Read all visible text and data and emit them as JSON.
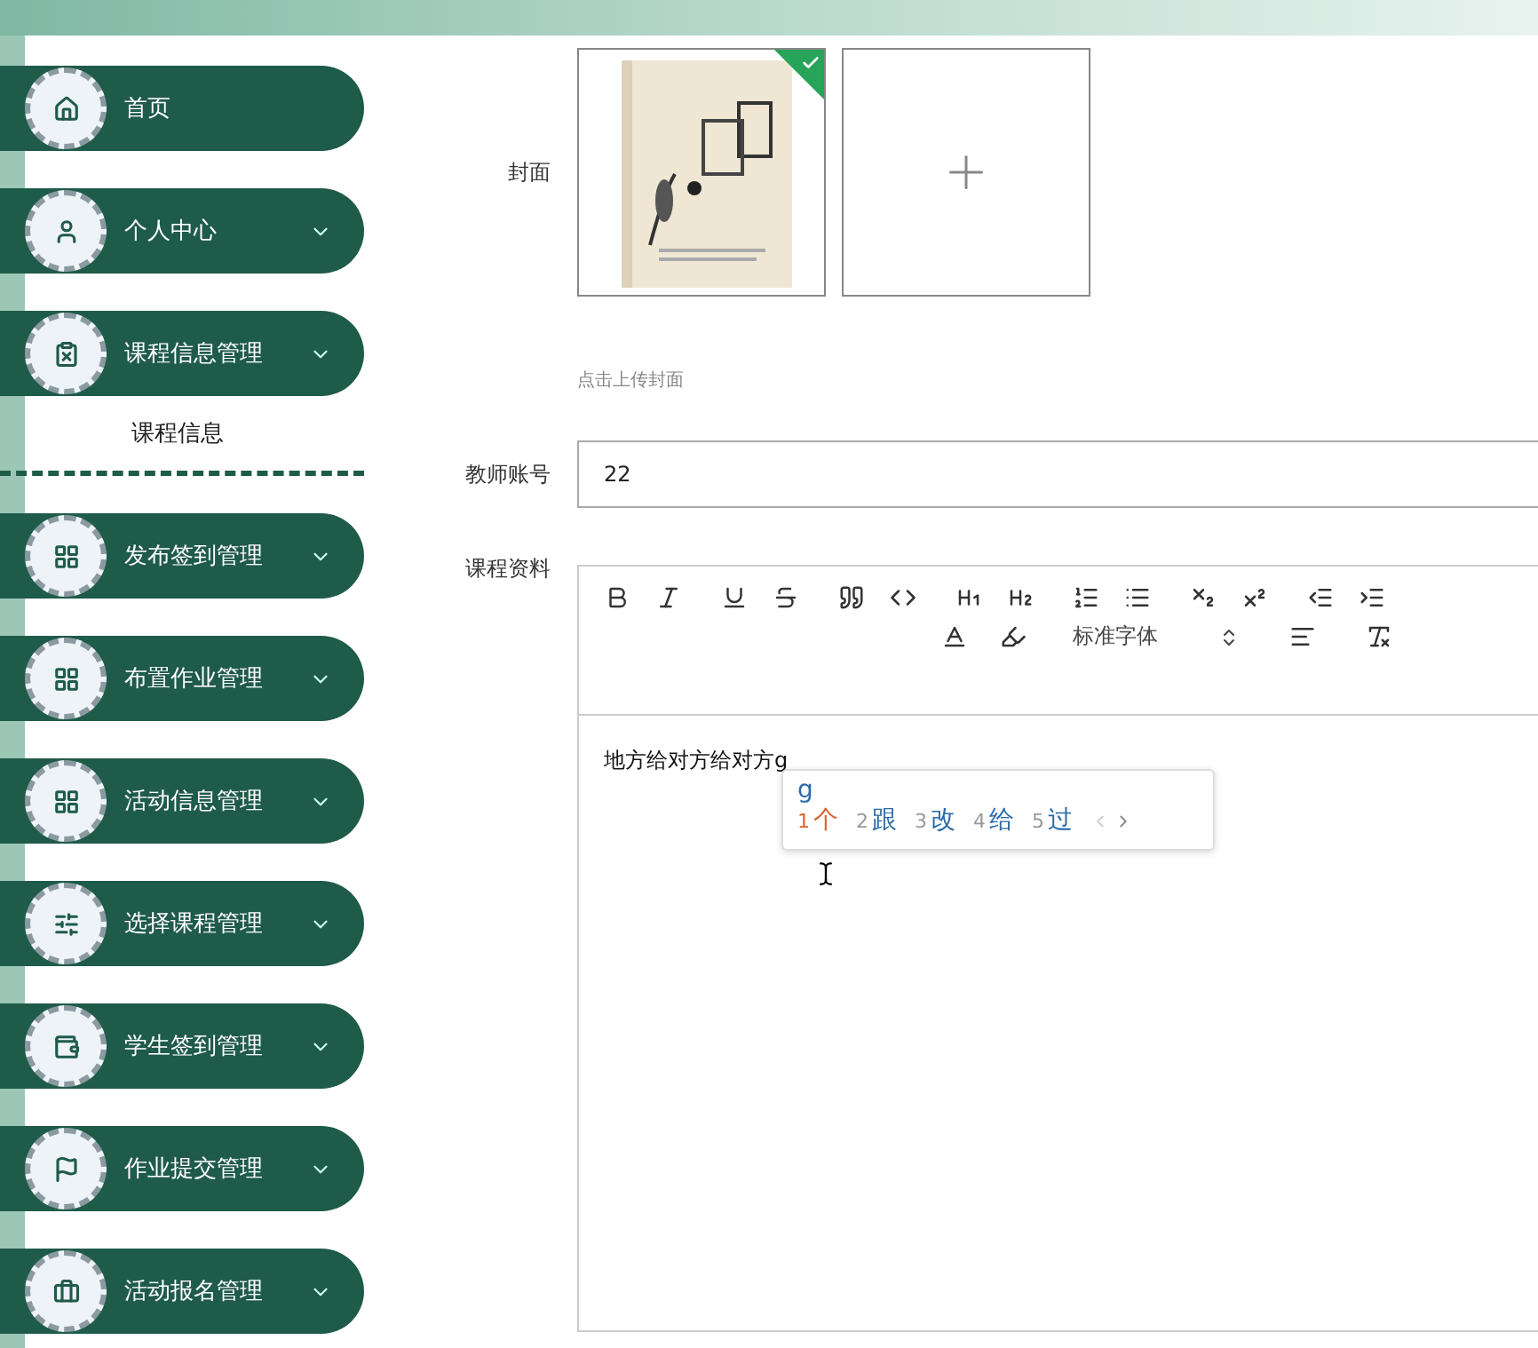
{
  "sidebar": {
    "items": [
      {
        "label": "首页",
        "expandable": false,
        "expanded": false
      },
      {
        "label": "个人中心",
        "expandable": true,
        "expanded": false
      },
      {
        "label": "课程信息管理",
        "expandable": true,
        "expanded": true,
        "children": [
          {
            "label": "课程信息"
          }
        ]
      },
      {
        "label": "发布签到管理",
        "expandable": true,
        "expanded": false
      },
      {
        "label": "布置作业管理",
        "expandable": true,
        "expanded": false
      },
      {
        "label": "活动信息管理",
        "expandable": true,
        "expanded": false
      },
      {
        "label": "选择课程管理",
        "expandable": true,
        "expanded": false
      },
      {
        "label": "学生签到管理",
        "expandable": true,
        "expanded": false
      },
      {
        "label": "作业提交管理",
        "expandable": true,
        "expanded": false
      },
      {
        "label": "活动报名管理",
        "expandable": true,
        "expanded": false
      }
    ]
  },
  "form": {
    "cover": {
      "label": "封面",
      "images": [
        {
          "kind": "picture",
          "selected": true
        }
      ],
      "hint": "点击上传封面"
    },
    "teacher_account": {
      "label": "教师账号",
      "value": "22"
    },
    "course_material": {
      "label": "课程资料",
      "font_select": "标准字体",
      "content": "地方给对方给对方g",
      "ime": {
        "composition": "g",
        "candidates": [
          {
            "index": "1",
            "text": "个",
            "selected": true
          },
          {
            "index": "2",
            "text": "跟",
            "selected": false
          },
          {
            "index": "3",
            "text": "改",
            "selected": false
          },
          {
            "index": "4",
            "text": "给",
            "selected": false
          },
          {
            "index": "5",
            "text": "过",
            "selected": false
          }
        ]
      }
    }
  }
}
